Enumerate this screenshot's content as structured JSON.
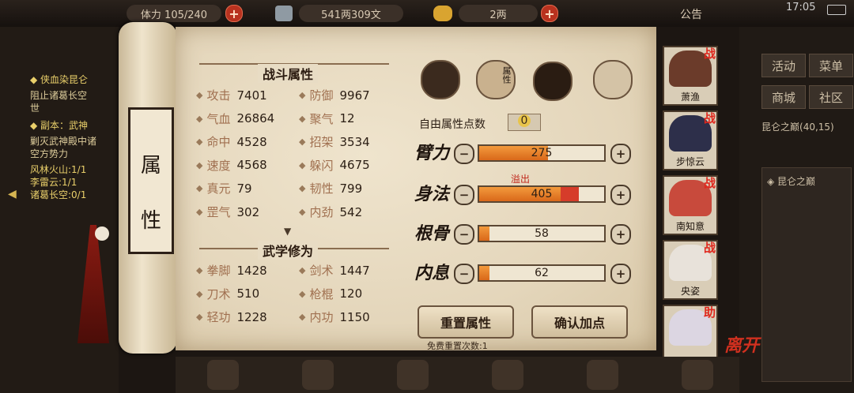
{
  "topbar": {
    "stamina": "体力 105/240",
    "coins": "541两309文",
    "gold": "2两",
    "notice": "公告",
    "time": "17:05"
  },
  "quests": {
    "q1_title": "侠血染昆仑",
    "q1_desc_a": "阻止诸葛长空",
    "q1_desc_b": "世",
    "q2_title": "副本：武神",
    "q2_desc_a": "剿灭武神殿中诸",
    "q2_desc_b": "空方势力",
    "progress": [
      {
        "label": "风林火山:",
        "value": "1/1"
      },
      {
        "label": "李雷云:",
        "value": "1/1"
      },
      {
        "label": "诸葛长空:",
        "value": "0/1"
      }
    ]
  },
  "rightmenu": {
    "buttons": [
      "活动",
      "菜单",
      "商城",
      "社区"
    ],
    "location": "昆仑之巅",
    "coords": "(40,15)",
    "sub_location": "昆仑之巅"
  },
  "scroll_tab": {
    "char1": "属",
    "char2": "性"
  },
  "combat": {
    "title": "战斗属性",
    "stats": [
      {
        "label": "攻击",
        "value": "7401"
      },
      {
        "label": "防御",
        "value": "9967"
      },
      {
        "label": "气血",
        "value": "26864"
      },
      {
        "label": "聚气",
        "value": "12"
      },
      {
        "label": "命中",
        "value": "4528"
      },
      {
        "label": "招架",
        "value": "3534"
      },
      {
        "label": "速度",
        "value": "4568"
      },
      {
        "label": "躲闪",
        "value": "4675"
      },
      {
        "label": "真元",
        "value": "79"
      },
      {
        "label": "韧性",
        "value": "799"
      },
      {
        "label": "罡气",
        "value": "302"
      },
      {
        "label": "内劲",
        "value": "542"
      }
    ]
  },
  "martial": {
    "title": "武学修为",
    "stats": [
      {
        "label": "拳脚",
        "value": "1428"
      },
      {
        "label": "剑术",
        "value": "1447"
      },
      {
        "label": "刀术",
        "value": "510"
      },
      {
        "label": "枪棍",
        "value": "120"
      },
      {
        "label": "轻功",
        "value": "1228"
      },
      {
        "label": "内功",
        "value": "1150"
      }
    ]
  },
  "tabs": {
    "attr_tab_label": "属性"
  },
  "free_points": {
    "label": "自由属性点数",
    "value": "0"
  },
  "attributes": [
    {
      "name": "臂力",
      "value": "275",
      "fill_ratio": 0.55,
      "overflow_label": ""
    },
    {
      "name": "身法",
      "value": "405",
      "fill_ratio": 0.65,
      "overflow_ratio": 0.15,
      "overflow_label": "溢出"
    },
    {
      "name": "根骨",
      "value": "58",
      "fill_ratio": 0.08,
      "overflow_label": ""
    },
    {
      "name": "内息",
      "value": "62",
      "fill_ratio": 0.08,
      "overflow_label": ""
    }
  ],
  "buttons": {
    "reset": "重置属性",
    "confirm": "确认加点",
    "free_reset": "免费重置次数:1"
  },
  "characters": [
    {
      "name": "萧渔",
      "badge": "战"
    },
    {
      "name": "步惊云",
      "badge": "战"
    },
    {
      "name": "南知意",
      "badge": "战"
    },
    {
      "name": "央姿",
      "badge": "战"
    },
    {
      "name": "",
      "badge": "助"
    }
  ],
  "leave_label": "离开",
  "colors": {
    "accent_orange": "#e27a22",
    "overflow_red": "#d63c2a",
    "badge_red": "#e0271d"
  }
}
